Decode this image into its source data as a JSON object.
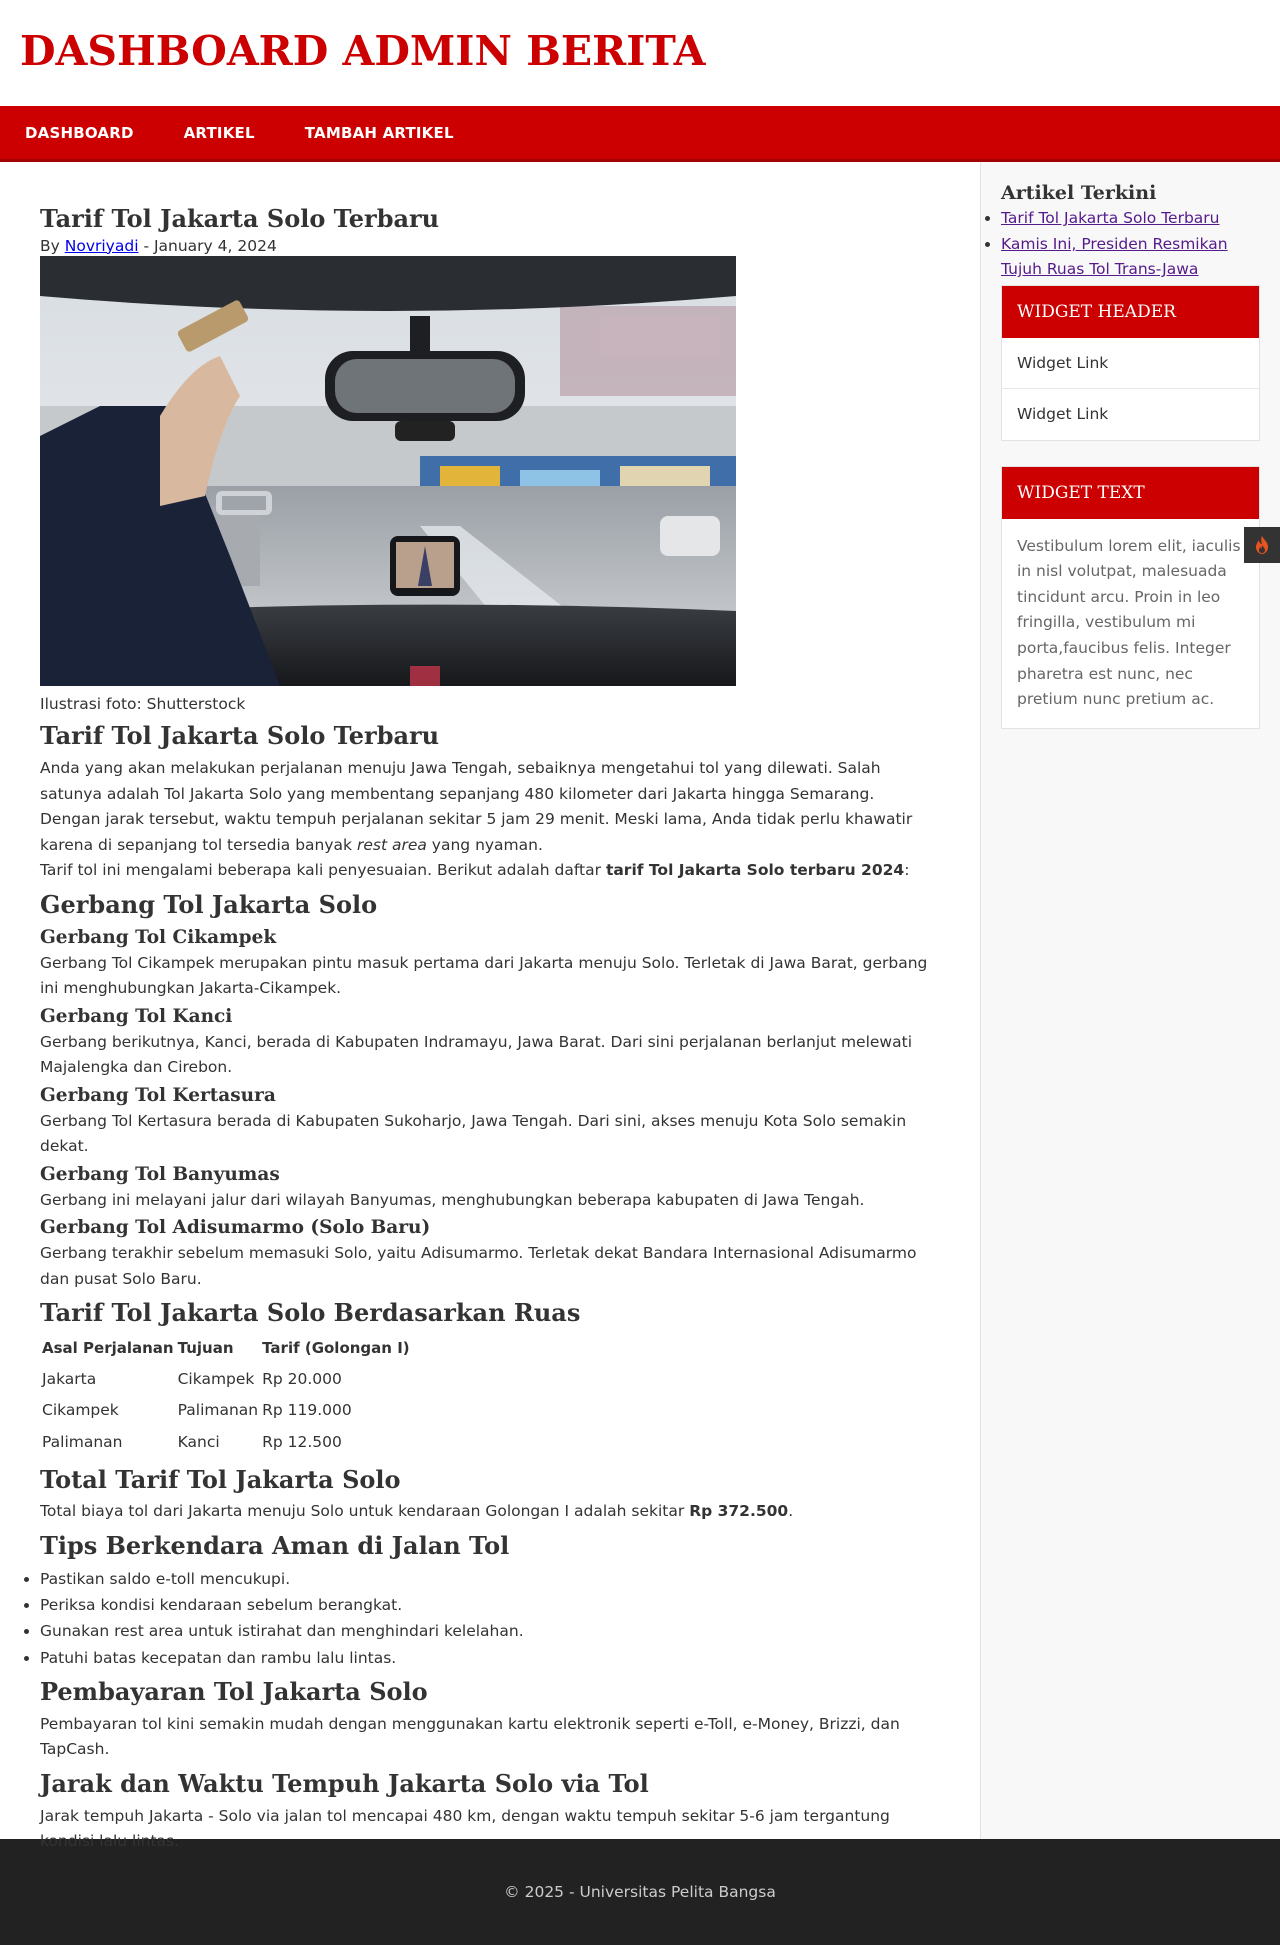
{
  "header": {
    "site_title": "DASHBOARD ADMIN BERITA"
  },
  "nav": {
    "items": [
      "DASHBOARD",
      "ARTIKEL",
      "TAMBAH ARTIKEL"
    ]
  },
  "article": {
    "title": "Tarif Tol Jakarta Solo Terbaru",
    "byline_prefix": "By",
    "author": "Novriyadi",
    "date_sep": "- January 4, 2024",
    "image_caption": "Ilustrasi foto: Shutterstock",
    "h2_intro": "Tarif Tol Jakarta Solo Terbaru",
    "p1": "Anda yang akan melakukan perjalanan menuju Jawa Tengah, sebaiknya mengetahui tol yang dilewati. Salah satunya adalah Tol Jakarta Solo yang membentang sepanjang 480 kilometer dari Jakarta hingga Semarang.",
    "p2_before": "Dengan jarak tersebut, waktu tempuh perjalanan sekitar 5 jam 29 menit. Meski lama, Anda tidak perlu khawatir karena di sepanjang tol tersedia banyak ",
    "p2_em": "rest area",
    "p2_after": " yang nyaman.",
    "p3_before": "Tarif tol ini mengalami beberapa kali penyesuaian. Berikut adalah daftar ",
    "p3_strong": "tarif Tol Jakarta Solo terbaru 2024",
    "p3_after": ":",
    "h2_gerbang": "Gerbang Tol Jakarta Solo",
    "gates": [
      {
        "name": "Gerbang Tol Cikampek",
        "desc": "Gerbang Tol Cikampek merupakan pintu masuk pertama dari Jakarta menuju Solo. Terletak di Jawa Barat, gerbang ini menghubungkan Jakarta-Cikampek."
      },
      {
        "name": "Gerbang Tol Kanci",
        "desc": "Gerbang berikutnya, Kanci, berada di Kabupaten Indramayu, Jawa Barat. Dari sini perjalanan berlanjut melewati Majalengka dan Cirebon."
      },
      {
        "name": "Gerbang Tol Kertasura",
        "desc": "Gerbang Tol Kertasura berada di Kabupaten Sukoharjo, Jawa Tengah. Dari sini, akses menuju Kota Solo semakin dekat."
      },
      {
        "name": "Gerbang Tol Banyumas",
        "desc": "Gerbang ini melayani jalur dari wilayah Banyumas, menghubungkan beberapa kabupaten di Jawa Tengah."
      },
      {
        "name": "Gerbang Tol Adisumarmo (Solo Baru)",
        "desc": "Gerbang terakhir sebelum memasuki Solo, yaitu Adisumarmo. Terletak dekat Bandara Internasional Adisumarmo dan pusat Solo Baru."
      }
    ],
    "h2_ruas": "Tarif Tol Jakarta Solo Berdasarkan Ruas",
    "table": {
      "headers": [
        "Asal Perjalanan",
        "Tujuan",
        "Tarif (Golongan I)"
      ],
      "rows": [
        [
          "Jakarta",
          "Cikampek",
          "Rp 20.000"
        ],
        [
          "Cikampek",
          "Palimanan",
          "Rp 119.000"
        ],
        [
          "Palimanan",
          "Kanci",
          "Rp 12.500"
        ]
      ]
    },
    "h2_total": "Total Tarif Tol Jakarta Solo",
    "total_before": "Total biaya tol dari Jakarta menuju Solo untuk kendaraan Golongan I adalah sekitar ",
    "total_strong": "Rp 372.500",
    "total_after": ".",
    "h2_tips": "Tips Berkendara Aman di Jalan Tol",
    "tips": [
      "Pastikan saldo e-toll mencukupi.",
      "Periksa kondisi kendaraan sebelum berangkat.",
      "Gunakan rest area untuk istirahat dan menghindari kelelahan.",
      "Patuhi batas kecepatan dan rambu lalu lintas."
    ],
    "h2_bayar": "Pembayaran Tol Jakarta Solo",
    "p_bayar": "Pembayaran tol kini semakin mudah dengan menggunakan kartu elektronik seperti e-Toll, e-Money, Brizzi, dan TapCash.",
    "h2_jarak": "Jarak dan Waktu Tempuh Jakarta Solo via Tol",
    "p_jarak": "Jarak tempuh Jakarta - Solo via jalan tol mencapai 480 km, dengan waktu tempuh sekitar 5-6 jam tergantung kondisi lalu lintas."
  },
  "sidebar": {
    "recent_title": "Artikel Terkini",
    "recent": [
      "Tarif Tol Jakarta Solo Terbaru",
      "Kamis Ini, Presiden Resmikan Tujuh Ruas Tol Trans-Jawa"
    ],
    "widget_header_title": "WIDGET HEADER",
    "widget_links": [
      "Widget Link",
      "Widget Link"
    ],
    "widget_text_title": "WIDGET TEXT",
    "widget_text_body": "Vestibulum lorem elit, iaculis in nisl volutpat, malesuada tincidunt arcu. Proin in leo fringilla, vestibulum mi porta,faucibus felis. Integer pharetra est nunc, nec pretium nunc pretium ac."
  },
  "footer": {
    "copyright": "© 2025 - Universitas Pelita Bangsa"
  },
  "colors": {
    "brand_red": "#cc0000",
    "footer_bg": "#222222",
    "sidebar_bg": "#f8f8f8"
  },
  "icons": {
    "side_tab": "flame-icon"
  }
}
